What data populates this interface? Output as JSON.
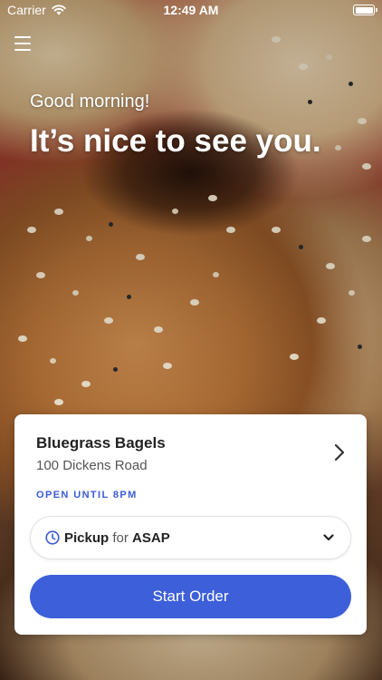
{
  "status_bar": {
    "carrier": "Carrier",
    "time": "12:49 AM",
    "wifi_icon": "wifi-icon",
    "battery_icon": "battery-icon"
  },
  "header": {
    "menu_icon": "hamburger-menu-icon",
    "greeting": "Good morning!",
    "headline": "It’s nice to see you."
  },
  "store_card": {
    "name": "Bluegrass Bagels",
    "address": "100 Dickens Road",
    "open_status": "OPEN UNTIL 8PM",
    "chevron_icon": "chevron-right-icon",
    "order_type": {
      "method": "Pickup",
      "connector": "for",
      "timing": "ASAP",
      "clock_icon": "clock-icon",
      "dropdown_icon": "chevron-down-icon"
    },
    "start_button_label": "Start Order"
  },
  "colors": {
    "accent": "#3d5fd9",
    "open_status": "#3b5ad6"
  }
}
